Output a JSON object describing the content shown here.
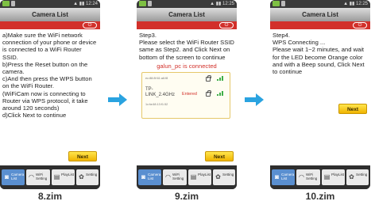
{
  "status_time": [
    "12:24",
    "12:25",
    "12:25"
  ],
  "title": "Camera List",
  "screens": [
    {
      "text": "a)Make sure the WiFi network connection of your phone or device is connected to a WiFi Router SSID.\nb)Press the Reset button on the camera.\nc)And then press the WPS button on the WiFi Router.\n(WiFiCam now is connecting to Router via WPS protocol, it take around 120 seconds)\nd)Click Next to continue",
      "next": "Next",
      "caption": "8.zim"
    },
    {
      "text": "Step3.\nPlease select the WiFi Router SSID same as Step2. and Click Next on bottom of the screen to continue",
      "connected": "galun_pc is connected",
      "wifi": [
        {
          "name": "",
          "mac": "ec:88:8f:61:a6:f8",
          "entered": "",
          "locked": true
        },
        {
          "name": "TP-LINK_2.4GHz",
          "mac": "1c:fa:68:13:f1:52",
          "entered": "Entered",
          "locked": true
        }
      ],
      "next": "Next",
      "caption": "9.zim"
    },
    {
      "text": "Step4.\nWPS Connecting ...\nPlease wait 1~2 minutes, and wait for the LED become Orange color and with a Beep sound, Click Next to continue",
      "next": "Next",
      "caption": "10.zim"
    }
  ],
  "tabs": [
    {
      "label": "Camera List",
      "icon": "camera-icon"
    },
    {
      "label": "WiFi Setting",
      "icon": "wifi-icon"
    },
    {
      "label": "PlayList",
      "icon": "playlist-icon"
    },
    {
      "label": "Setting",
      "icon": "gear-icon"
    }
  ],
  "colors": {
    "accent_red": "#d2302a",
    "next_yellow": "#f0b400",
    "arrow_blue": "#2aa3e0",
    "active_tab": "#5a8fd0"
  }
}
